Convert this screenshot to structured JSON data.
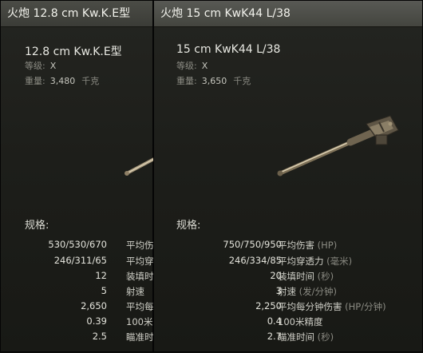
{
  "back_card": {
    "title": "火炮 12.8 cm Kw.K.E型",
    "gun_name": "12.8 cm Kw.K.E型",
    "tier_label": "等级:",
    "tier_value": "X",
    "weight_label": "重量:",
    "weight_value": "3,480",
    "weight_unit": "千克",
    "specs_title": "规格:",
    "specs": [
      {
        "value": "530/530/670",
        "label": "平均伤"
      },
      {
        "value": "246/311/65",
        "label": "平均穿"
      },
      {
        "value": "12",
        "label": "装填时"
      },
      {
        "value": "5",
        "label": "射速"
      },
      {
        "value": "2,650",
        "label": "平均每"
      },
      {
        "value": "0.39",
        "label": "100米"
      },
      {
        "value": "2.5",
        "label": "瞄准时"
      }
    ]
  },
  "front_card": {
    "title": "火炮 15 cm KwK44 L/38",
    "gun_name": "15 cm KwK44 L/38",
    "tier_label": "等级:",
    "tier_value": "X",
    "weight_label": "重量:",
    "weight_value": "3,650",
    "weight_unit": "千克",
    "specs_title": "规格:",
    "specs": [
      {
        "value": "750/750/950",
        "label": "平均伤害",
        "unit": "(HP)"
      },
      {
        "value": "246/334/85",
        "label": "平均穿透力",
        "unit": "(毫米)"
      },
      {
        "value": "20",
        "label": "装填时间",
        "unit": "(秒)"
      },
      {
        "value": "3",
        "label": "射速",
        "unit": "(发/分钟)"
      },
      {
        "value": "2,250",
        "label": "平均每分钟伤害",
        "unit": "(HP/分钟)"
      },
      {
        "value": "0.4",
        "label": "100米精度",
        "unit": ""
      },
      {
        "value": "2.7",
        "label": "瞄准时间",
        "unit": "(秒)"
      }
    ]
  },
  "colors": {
    "title_text": "#f2f2ec",
    "value_text": "#e4e4dc",
    "muted_text": "#8a8a82"
  },
  "icons": [
    "gun-barrel-icon"
  ]
}
